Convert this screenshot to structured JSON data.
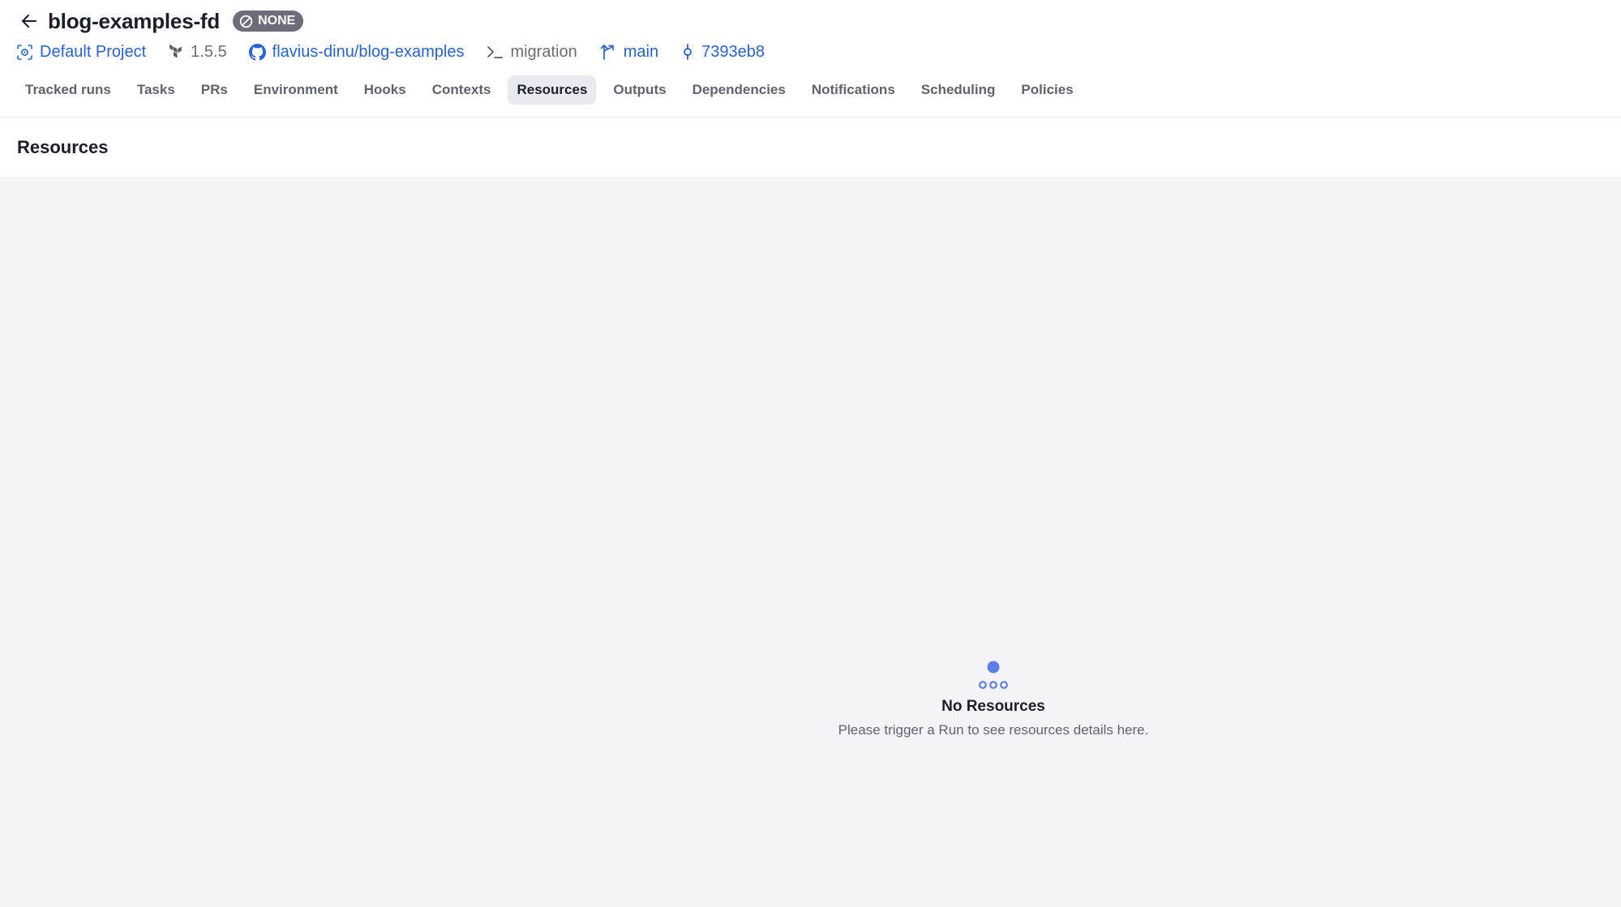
{
  "header": {
    "stack_name": "blog-examples-fd",
    "badge_label": "NONE",
    "meta": {
      "project": "Default Project",
      "tf_version": "1.5.5",
      "repository": "flavius-dinu/blog-examples",
      "path": "migration",
      "branch": "main",
      "commit": "7393eb8"
    }
  },
  "tabs": [
    {
      "label": "Tracked runs",
      "active": false
    },
    {
      "label": "Tasks",
      "active": false
    },
    {
      "label": "PRs",
      "active": false
    },
    {
      "label": "Environment",
      "active": false
    },
    {
      "label": "Hooks",
      "active": false
    },
    {
      "label": "Contexts",
      "active": false
    },
    {
      "label": "Resources",
      "active": true
    },
    {
      "label": "Outputs",
      "active": false
    },
    {
      "label": "Dependencies",
      "active": false
    },
    {
      "label": "Notifications",
      "active": false
    },
    {
      "label": "Scheduling",
      "active": false
    },
    {
      "label": "Policies",
      "active": false
    }
  ],
  "section": {
    "title": "Resources"
  },
  "empty_state": {
    "title": "No Resources",
    "description": "Please trigger a Run to see resources details here."
  },
  "colors": {
    "link": "#2563d6",
    "badge_bg": "#6b6e7a",
    "content_bg": "#f4f4f8",
    "icon_accent": "#5b7fe6"
  },
  "icons": {
    "back": "arrow-left-icon",
    "badge": "no-entry-icon",
    "project": "project-icon",
    "tf_version": "terraform-icon",
    "repository": "github-icon",
    "path": "terminal-prompt-icon",
    "branch": "branch-icon",
    "commit": "commit-icon",
    "empty": "resources-tree-icon"
  }
}
